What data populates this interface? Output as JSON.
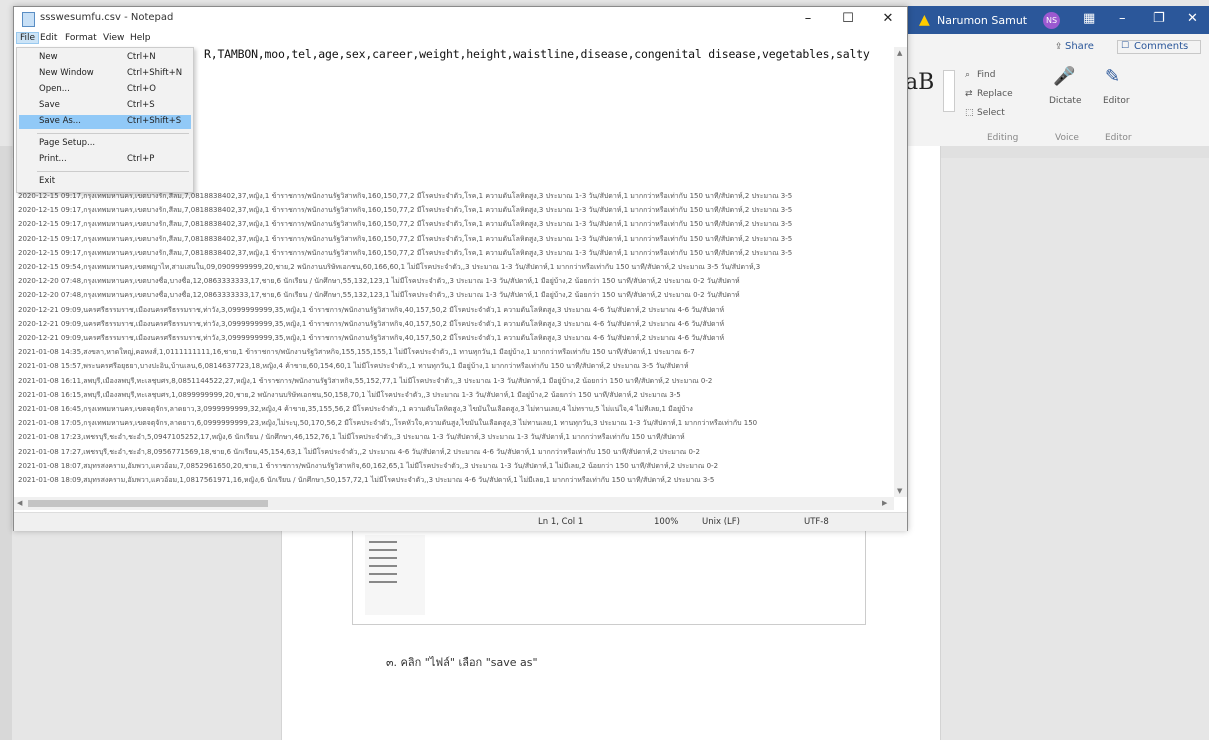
{
  "word": {
    "user_name": "Narumon Samut",
    "user_initials": "NS",
    "ribbon": {
      "share": "Share",
      "comments": "Comments",
      "style_sample": "aB",
      "find": "Find",
      "replace": "Replace",
      "select": "Select",
      "editing_group": "Editing",
      "dictate": "Dictate",
      "voice_group": "Voice",
      "editor": "Editor",
      "editor_group": "Editor"
    },
    "caption": "๓. คลิก \"ไฟล์\" เลือก \"save as\""
  },
  "notepad": {
    "title": "ssswesumfu.csv - Notepad",
    "menus": [
      "File",
      "Edit",
      "Format",
      "View",
      "Help"
    ],
    "header_line": "R,TAMBON,moo,tel,age,sex,career,weight,height,waistline,disease,congenital disease,vegetables,salty",
    "file_menu": {
      "items": [
        {
          "label": "New",
          "shortcut": "Ctrl+N"
        },
        {
          "label": "New Window",
          "shortcut": "Ctrl+Shift+N"
        },
        {
          "label": "Open...",
          "shortcut": "Ctrl+O"
        },
        {
          "label": "Save",
          "shortcut": "Ctrl+S"
        },
        {
          "label": "Save As...",
          "shortcut": "Ctrl+Shift+S"
        },
        {
          "label": "Page Setup...",
          "shortcut": ""
        },
        {
          "label": "Print...",
          "shortcut": "Ctrl+P"
        },
        {
          "label": "Exit",
          "shortcut": ""
        }
      ],
      "highlighted_index": 4
    },
    "lines": [
      "2020-12-15 09:17,กรุงเทพมหานคร,เขตบางรัก,สีลม,7,0818838402,37,หญิง,1 ข้าราชการ/พนักงานรัฐวิสาหกิจ,160,150,77,2 มีโรคประจำตัว,โรค,1 ความดันโลหิตสูง,3 ประมาณ 1-3 วัน/สัปดาห์,1 มากกว่าหรือเท่ากับ 150 นาที/สัปดาห์,2 ประมาณ 3-5",
      "2020-12-15 09:17,กรุงเทพมหานคร,เขตบางรัก,สีลม,7,0818838402,37,หญิง,1 ข้าราชการ/พนักงานรัฐวิสาหกิจ,160,150,77,2 มีโรคประจำตัว,โรค,1 ความดันโลหิตสูง,3 ประมาณ 1-3 วัน/สัปดาห์,1 มากกว่าหรือเท่ากับ 150 นาที/สัปดาห์,2 ประมาณ 3-5",
      "2020-12-15 09:17,กรุงเทพมหานคร,เขตบางรัก,สีลม,7,0818838402,37,หญิง,1 ข้าราชการ/พนักงานรัฐวิสาหกิจ,160,150,77,2 มีโรคประจำตัว,โรค,1 ความดันโลหิตสูง,3 ประมาณ 1-3 วัน/สัปดาห์,1 มากกว่าหรือเท่ากับ 150 นาที/สัปดาห์,2 ประมาณ 3-5",
      "2020-12-15 09:17,กรุงเทพมหานคร,เขตบางรัก,สีลม,7,0818838402,37,หญิง,1 ข้าราชการ/พนักงานรัฐวิสาหกิจ,160,150,77,2 มีโรคประจำตัว,โรค,1 ความดันโลหิตสูง,3 ประมาณ 1-3 วัน/สัปดาห์,1 มากกว่าหรือเท่ากับ 150 นาที/สัปดาห์,2 ประมาณ 3-5",
      "2020-12-15 09:17,กรุงเทพมหานคร,เขตบางรัก,สีลม,7,0818838402,37,หญิง,1 ข้าราชการ/พนักงานรัฐวิสาหกิจ,160,150,77,2 มีโรคประจำตัว,โรค,1 ความดันโลหิตสูง,3 ประมาณ 1-3 วัน/สัปดาห์,1 มากกว่าหรือเท่ากับ 150 นาที/สัปดาห์,2 ประมาณ 3-5",
      "2020-12-15 09:54,กรุงเทพมหานคร,เขตพญาไท,สามเสนใน,09,0909999999,20,ชาย,2 พนักงานบริษัทเอกชน,60,166,60,1 ไม่มีโรคประจำตัว,,3 ประมาณ 1-3 วัน/สัปดาห์,1 มากกว่าหรือเท่ากับ 150 นาที/สัปดาห์,2 ประมาณ 3-5 วัน/สัปดาห์,3",
      "2020-12-20 07:48,กรุงเทพมหานคร,เขตบางซื่อ,บางซื่อ,12,0863333333,17,ชาย,6 นักเรียน / นักศึกษา,55,132,123,1 ไม่มีโรคประจำตัว,,3 ประมาณ 1-3 วัน/สัปดาห์,1 มีอยู่บ้าง,2 น้อยกว่า 150 นาที/สัปดาห์,2 ประมาณ 0-2 วัน/สัปดาห์",
      "2020-12-20 07:48,กรุงเทพมหานคร,เขตบางซื่อ,บางซื่อ,12,0863333333,17,ชาย,6 นักเรียน / นักศึกษา,55,132,123,1 ไม่มีโรคประจำตัว,,3 ประมาณ 1-3 วัน/สัปดาห์,1 มีอยู่บ้าง,2 น้อยกว่า 150 นาที/สัปดาห์,2 ประมาณ 0-2 วัน/สัปดาห์",
      "2020-12-21 09:09,นครศรีธรรมราช,เมืองนครศรีธรรมราช,ท่าวัง,3,0999999999,35,หญิง,1 ข้าราชการ/พนักงานรัฐวิสาหกิจ,40,157,50,2 มีโรคประจำตัว,1 ความดันโลหิตสูง,3 ประมาณ 4-6 วัน/สัปดาห์,2 ประมาณ 4-6 วัน/สัปดาห์",
      "2020-12-21 09:09,นครศรีธรรมราช,เมืองนครศรีธรรมราช,ท่าวัง,3,0999999999,35,หญิง,1 ข้าราชการ/พนักงานรัฐวิสาหกิจ,40,157,50,2 มีโรคประจำตัว,1 ความดันโลหิตสูง,3 ประมาณ 4-6 วัน/สัปดาห์,2 ประมาณ 4-6 วัน/สัปดาห์",
      "2020-12-21 09:09,นครศรีธรรมราช,เมืองนครศรีธรรมราช,ท่าวัง,3,0999999999,35,หญิง,1 ข้าราชการ/พนักงานรัฐวิสาหกิจ,40,157,50,2 มีโรคประจำตัว,1 ความดันโลหิตสูง,3 ประมาณ 4-6 วัน/สัปดาห์,2 ประมาณ 4-6 วัน/สัปดาห์",
      "2021-01-08 14:35,สงขลา,หาดใหญ่,คอหงส์,1,0111111111,16,ชาย,1 ข้าราชการ/พนักงานรัฐวิสาหกิจ,155,155,155,1 ไม่มีโรคประจำตัว,,1 ทานทุกวัน,1 มีอยู่บ้าง,1 มากกว่าหรือเท่ากับ 150 นาที/สัปดาห์,1 ประมาณ 6-7",
      "2021-01-08 15:57,พระนครศรีอยุธยา,บางปะอิน,บ้านเลน,6,0814637723,18,หญิง,4 ค้าขาย,60,154,60,1 ไม่มีโรคประจำตัว,,1 ทานทุกวัน,1 มีอยู่บ้าง,1 มากกว่าหรือเท่ากับ 150 นาที/สัปดาห์,2 ประมาณ 3-5 วัน/สัปดาห์",
      "2021-01-08 16:11,ลพบุรี,เมืองลพบุรี,ทะเลชุบศร,8,0851144522,27,หญิง,1 ข้าราชการ/พนักงานรัฐวิสาหกิจ,55,152,77,1 ไม่มีโรคประจำตัว,,3 ประมาณ 1-3 วัน/สัปดาห์,1 มีอยู่บ้าง,2 น้อยกว่า 150 นาที/สัปดาห์,2 ประมาณ 0-2",
      "2021-01-08 16:15,ลพบุรี,เมืองลพบุรี,ทะเลชุบศร,1,0899999999,20,ชาย,2 พนักงานบริษัทเอกชน,50,158,70,1 ไม่มีโรคประจำตัว,,3 ประมาณ 1-3 วัน/สัปดาห์,1 มีอยู่บ้าง,2 น้อยกว่า 150 นาที/สัปดาห์,2 ประมาณ 3-5",
      "2021-01-08 16:45,กรุงเทพมหานคร,เขตจตุจักร,ลาดยาว,3,0999999999,32,หญิง,4 ค้าขาย,35,155,56,2 มีโรคประจำตัว,,1 ความดันโลหิตสูง,3 ไขมันในเลือดสูง,3 ไม่ทานเลย,4 ไม่ทราบ,5 ไม่แน่ใจ,4 ไม่ทีเลย,1 มีอยู่บ้าง",
      "2021-01-08 17:05,กรุงเทพมหานคร,เขตจตุจักร,ลาดยาว,6,0999999999,23,หญิง,ไม่ระบุ,50,170,56,2 มีโรคประจำตัว,,โรคหัวใจ,ความดันสูง,ไขมันในเลือดสูง,3 ไม่ทานเลย,1 ทานทุกวัน,3 ประมาณ 1-3 วัน/สัปดาห์,1 มากกว่าหรือเท่ากับ 150",
      "2021-01-08 17:23,เพชรบุรี,ชะอำ,ชะอำ,5,0947105252,17,หญิง,6 นักเรียน / นักศึกษา,46,152,76,1 ไม่มีโรคประจำตัว,,3 ประมาณ 1-3 วัน/สัปดาห์,3 ประมาณ 1-3 วัน/สัปดาห์,1 มากกว่าหรือเท่ากับ 150 นาที/สัปดาห์",
      "2021-01-08 17:27,เพชรบุรี,ชะอำ,ชะอำ,8,0956771569,18,ชาย,6 นักเรียน,45,154,63,1 ไม่มีโรคประจำตัว,,2 ประมาณ 4-6 วัน/สัปดาห์,2 ประมาณ 4-6 วัน/สัปดาห์,1 มากกว่าหรือเท่ากับ 150 นาที/สัปดาห์,2 ประมาณ 0-2",
      "2021-01-08 18:07,สมุทรสงคราม,อัมพวา,แควอ้อม,7,0852961650,20,ชาย,1 ข้าราชการ/พนักงานรัฐวิสาหกิจ,60,162,65,1 ไม่มีโรคประจำตัว,,3 ประมาณ 1-3 วัน/สัปดาห์,1 ไม่มีเลย,2 น้อยกว่า 150 นาที/สัปดาห์,2 ประมาณ 0-2",
      "2021-01-08 18:09,สมุทรสงคราม,อัมพวา,แควอ้อม,1,0817561971,16,หญิง,6 นักเรียน / นักศึกษา,50,157,72,1 ไม่มีโรคประจำตัว,,3 ประมาณ 4-6 วัน/สัปดาห์,1 ไม่มีเลย,1 มากกว่าหรือเท่ากับ 150 นาที/สัปดาห์,2 ประมาณ 3-5"
    ],
    "status": {
      "position": "Ln 1, Col 1",
      "zoom": "100%",
      "line_ending": "Unix (LF)",
      "encoding": "UTF-8"
    }
  },
  "colors": {
    "word_titlebar": "#2b579a",
    "menu_highlight": "#91c9f7"
  }
}
